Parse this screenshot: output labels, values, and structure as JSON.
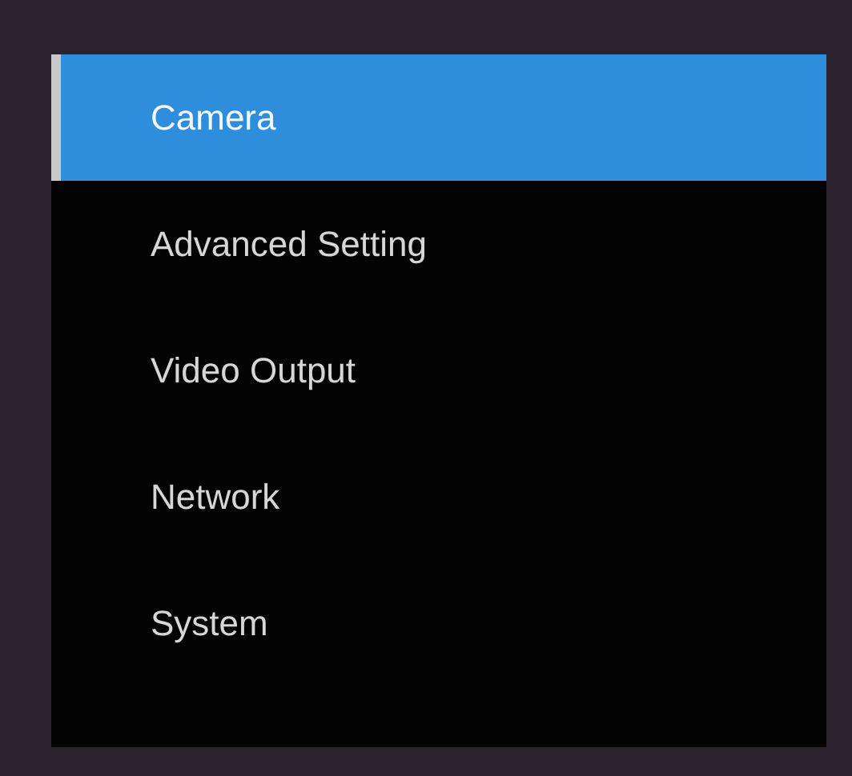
{
  "menu": {
    "items": [
      {
        "label": "Camera",
        "selected": true
      },
      {
        "label": "Advanced Setting",
        "selected": false
      },
      {
        "label": "Video Output",
        "selected": false
      },
      {
        "label": "Network",
        "selected": false
      },
      {
        "label": "System",
        "selected": false
      }
    ]
  }
}
